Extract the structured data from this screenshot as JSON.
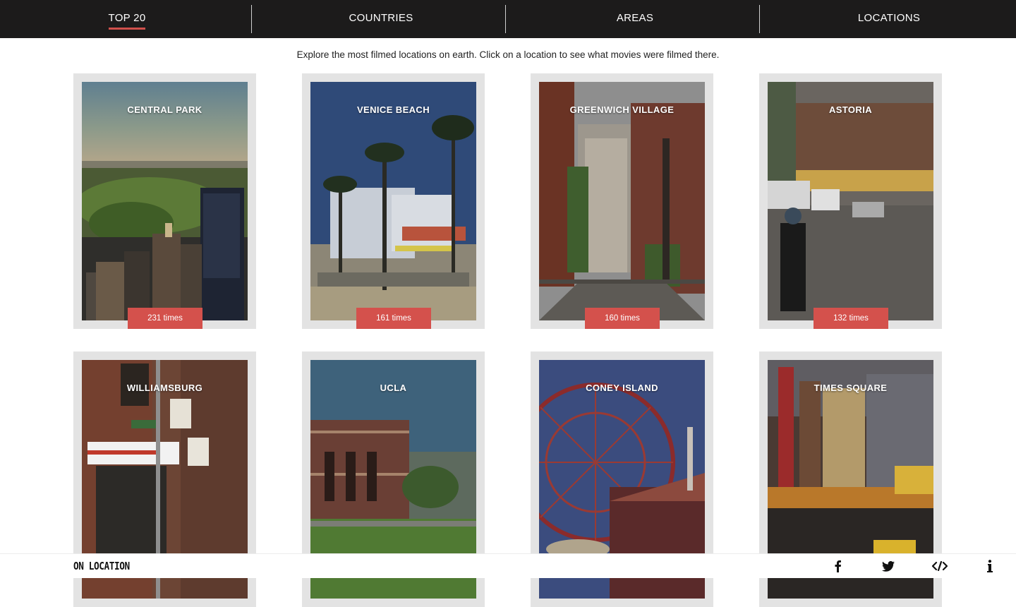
{
  "nav": {
    "tabs": [
      {
        "label": "TOP 20",
        "active": true
      },
      {
        "label": "COUNTRIES",
        "active": false
      },
      {
        "label": "AREAS",
        "active": false
      },
      {
        "label": "LOCATIONS",
        "active": false
      }
    ]
  },
  "intro": "Explore the most filmed locations on earth. Click on a location to see what movies were filmed there.",
  "locations": [
    {
      "name": "CENTRAL PARK",
      "count": "231 times"
    },
    {
      "name": "VENICE BEACH",
      "count": "161 times"
    },
    {
      "name": "GREENWICH VILLAGE",
      "count": "160 times"
    },
    {
      "name": "ASTORIA",
      "count": "132 times"
    },
    {
      "name": "WILLIAMSBURG",
      "count": ""
    },
    {
      "name": "UCLA",
      "count": ""
    },
    {
      "name": "CONEY ISLAND",
      "count": ""
    },
    {
      "name": "TIMES SQUARE",
      "count": ""
    }
  ],
  "footer": {
    "brand": "ON LOCATION",
    "icons": [
      "facebook-icon",
      "twitter-icon",
      "embed-code-icon",
      "info-icon"
    ]
  },
  "colors": {
    "nav_bg": "#1c1b1b",
    "accent": "#d4514c",
    "card_bg": "#e3e3e3"
  }
}
